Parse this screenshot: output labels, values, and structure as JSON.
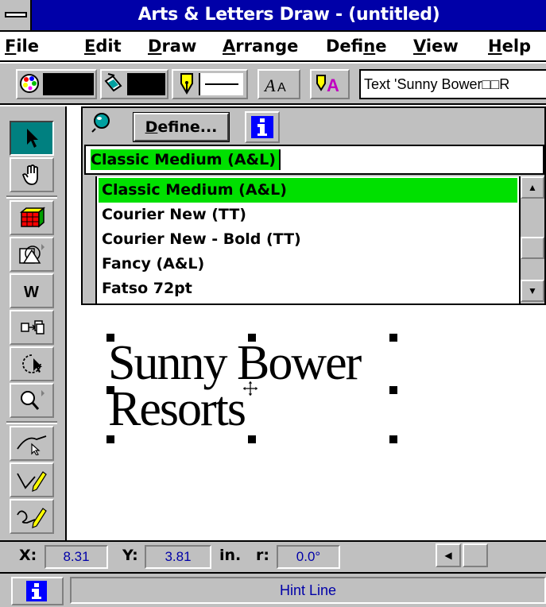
{
  "window": {
    "title": "Arts & Letters Draw - (untitled)"
  },
  "menu": [
    {
      "label": "File",
      "u": "F",
      "rest": "ile"
    },
    {
      "label": "Edit",
      "u": "E",
      "rest": "dit"
    },
    {
      "label": "Draw",
      "u": "D",
      "rest": "raw"
    },
    {
      "label": "Arrange",
      "u": "A",
      "rest": "rrange"
    },
    {
      "label": "Define",
      "pre": "Defi",
      "u": "n",
      "rest": "e"
    },
    {
      "label": "View",
      "u": "V",
      "rest": "iew"
    },
    {
      "label": "Help",
      "u": "H",
      "rest": "elp"
    }
  ],
  "toolbar": {
    "text_status": "Text 'Sunny Bower□□R",
    "buttons": [
      "fill-palette-icon",
      "paint-bucket-icon",
      "pen-nib-icon",
      "type-style-icon",
      "text-color-icon"
    ]
  },
  "font_panel": {
    "define_label": "Define...",
    "define_underline": "D",
    "define_rest": "efine...",
    "current_font": "Classic Medium (A&L)",
    "fonts": [
      "Classic Medium (A&L)",
      "Courier New (TT)",
      "Courier New - Bold (TT)",
      "Fancy (A&L)",
      "Fatso 72pt"
    ],
    "selected_index": 0
  },
  "canvas": {
    "text_line1": "Sunny Bower",
    "text_line2": "Resorts"
  },
  "coords": {
    "x_label": "X:",
    "x_value": "8.31",
    "y_label": "Y:",
    "y_value": "3.81",
    "unit": "in.",
    "r_label": "r:",
    "r_value": "0.0°"
  },
  "hint": {
    "text": "Hint Line"
  },
  "colors": {
    "titlebar": "#0000a8",
    "selection": "#00e000",
    "active_tool": "#008080",
    "status_text": "#0000a8"
  }
}
